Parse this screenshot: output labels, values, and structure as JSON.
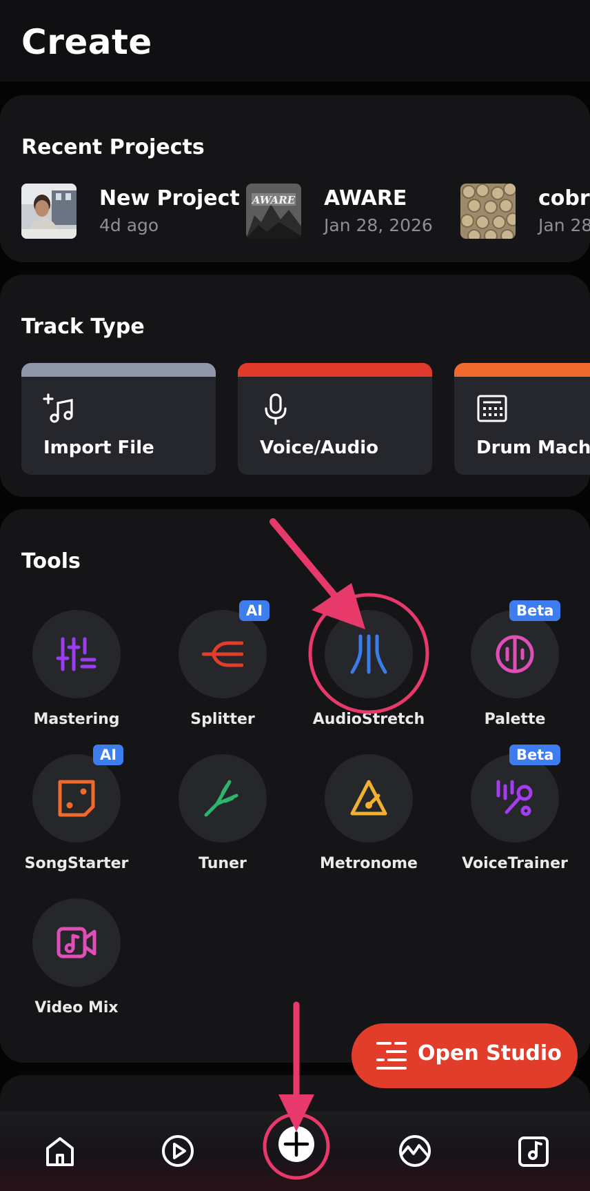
{
  "header": {
    "title": "Create"
  },
  "recent": {
    "title": "Recent Projects",
    "projects": [
      {
        "name": "New Project",
        "date": "4d ago"
      },
      {
        "name": "AWARE",
        "date": "Jan 28, 2026"
      },
      {
        "name": "cobra",
        "date": "Jan 28"
      }
    ]
  },
  "tracks": {
    "title": "Track Type",
    "items": [
      {
        "label": "Import File",
        "accent": "#8f98a8",
        "icon": "music-note-plus-icon"
      },
      {
        "label": "Voice/Audio",
        "accent": "#e03a2c",
        "icon": "microphone-icon"
      },
      {
        "label": "Drum Machine",
        "accent": "#ef6a2c",
        "icon": "drum-pad-icon"
      }
    ]
  },
  "tools": {
    "title": "Tools",
    "items": [
      {
        "label": "Mastering",
        "icon": "sliders-icon",
        "color": "#9b3cf0"
      },
      {
        "label": "Splitter",
        "icon": "splitter-icon",
        "color": "#e23d2b",
        "badge": "AI"
      },
      {
        "label": "AudioStretch",
        "icon": "audiostretch-icon",
        "color": "#3d7be8"
      },
      {
        "label": "Palette",
        "icon": "palette-icon",
        "color": "#e04fb8",
        "badge": "Beta"
      },
      {
        "label": "SongStarter",
        "icon": "dice-icon",
        "color": "#ef6a2c",
        "badge": "AI"
      },
      {
        "label": "Tuner",
        "icon": "tuning-fork-icon",
        "color": "#2fb56b"
      },
      {
        "label": "Metronome",
        "icon": "metronome-icon",
        "color": "#f2b22f"
      },
      {
        "label": "VoiceTrainer",
        "icon": "voice-trainer-icon",
        "color": "#a43cf0",
        "badge": "Beta"
      },
      {
        "label": "Video Mix",
        "icon": "video-music-icon",
        "color": "#e04fb8"
      }
    ]
  },
  "fab": {
    "label": "Open Studio",
    "color": "#e23d2b"
  },
  "annotation_color": "#e8396b",
  "nav": [
    "home-icon",
    "play-icon",
    "create-plus-icon",
    "activity-icon",
    "library-icon"
  ]
}
